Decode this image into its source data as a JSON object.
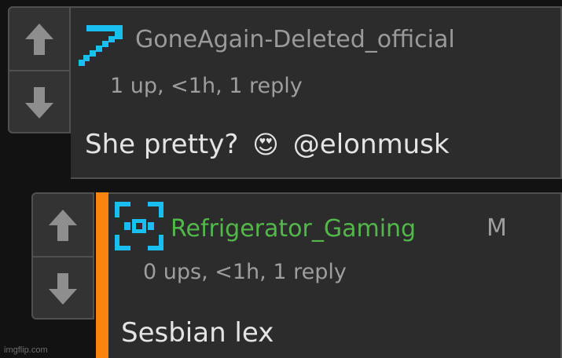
{
  "comments": [
    {
      "username": "GoneAgain-Deleted_official",
      "username_color": "#9a9a9a",
      "avatar_icon": "pickaxe-icon",
      "meta": "1 up, <1h, 1 reply",
      "text": "She pretty?",
      "emoji": "😍",
      "mention": "@elonmusk"
    },
    {
      "username": "Refrigerator_Gaming",
      "username_color": "#53b84a",
      "avatar_icon": "frame-icon",
      "mod_badge": "M",
      "meta": "0 ups, <1h, 1 reply",
      "text": "Sesbian lex",
      "accent_color": "#f7850f"
    }
  ],
  "icons": {
    "upvote": "arrow-up-icon",
    "downvote": "arrow-down-icon"
  },
  "watermark": "imgflip.com"
}
